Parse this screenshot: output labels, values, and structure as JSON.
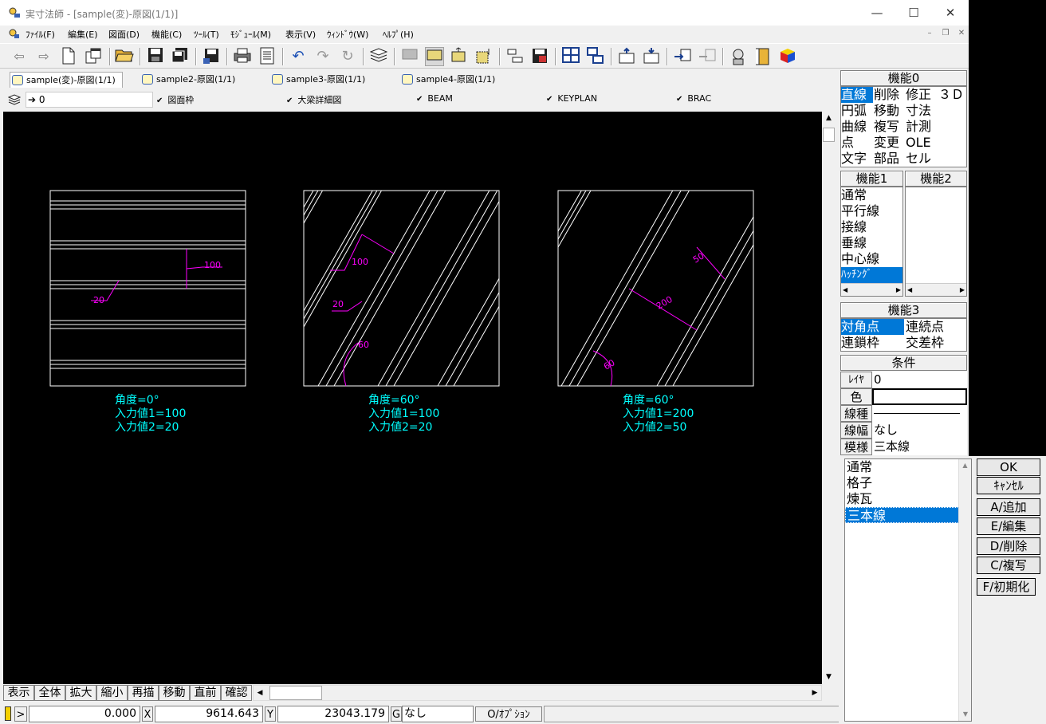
{
  "window": {
    "title": "実寸法師 - [sample(変)-原図(1/1)]",
    "min": "—",
    "max": "☐",
    "close": "✕"
  },
  "menu": [
    "ﾌｧｲﾙ(F)",
    "編集(E)",
    "図面(D)",
    "機能(C)",
    "ﾂｰﾙ(T)",
    "ﾓｼﾞｭｰﾙ(M)",
    "表示(V)",
    "ｳｨﾝﾄﾞｳ(W)",
    "ﾍﾙﾌﾟ(H)"
  ],
  "mdi": {
    "min": "–",
    "restore": "❐",
    "close": "✕"
  },
  "tabs": [
    {
      "label": "sample(変)-原図(1/1)",
      "active": true
    },
    {
      "label": "sample2-原図(1/1)",
      "active": false
    },
    {
      "label": "sample3-原図(1/1)",
      "active": false
    },
    {
      "label": "sample4-原図(1/1)",
      "active": false
    }
  ],
  "layers": {
    "current": "0",
    "items": [
      "図面枠",
      "大梁詳細図",
      "BEAM",
      "KEYPLAN",
      "BRAC"
    ]
  },
  "drawing": {
    "panels": [
      {
        "dims": [
          "100",
          "20"
        ],
        "captions": [
          "角度=0°",
          "入力値1=100",
          "入力値2=20"
        ]
      },
      {
        "dims": [
          "100",
          "20",
          "60"
        ],
        "captions": [
          "角度=60°",
          "入力値1=100",
          "入力値2=20"
        ]
      },
      {
        "dims": [
          "50",
          "200",
          "60"
        ],
        "captions": [
          "角度=60°",
          "入力値1=200",
          "入力値2=50"
        ]
      }
    ]
  },
  "commands": [
    "表示",
    "全体",
    "拡大",
    "縮小",
    "再描",
    "移動",
    "直前",
    "確認"
  ],
  "status": {
    "x_label": "X",
    "x_value": "9614.643",
    "y_label": "Y",
    "y_value": "23043.179",
    "prev_value": "0.000",
    "g_label": "G",
    "g_value": "なし",
    "option": "O/ｵﾌﾟｼｮﾝ"
  },
  "panel": {
    "kino0": {
      "header": "機能0",
      "rows": [
        [
          "直線",
          "削除",
          "修正",
          "３Ｄ"
        ],
        [
          "円弧",
          "移動",
          "寸法",
          ""
        ],
        [
          "曲線",
          "複写",
          "計測",
          ""
        ],
        [
          "点",
          "変更",
          "OLE",
          ""
        ],
        [
          "文字",
          "部品",
          "セル",
          ""
        ]
      ]
    },
    "kino1": {
      "header": "機能1",
      "items": [
        "通常",
        "平行線",
        "接線",
        "垂線",
        "中心線",
        "ﾊｯﾁﾝｸﾞ"
      ]
    },
    "kino2": {
      "header": "機能2"
    },
    "kino3": {
      "header": "機能3",
      "items": [
        "対角点",
        "連続点",
        "連鎖枠",
        "交差枠"
      ]
    },
    "conditions": {
      "header": "条件",
      "layer_label": "ﾚｲﾔ",
      "layer_value": "0",
      "color_label": "色",
      "linetype_label": "線種",
      "linewidth_label": "線幅",
      "linewidth_value": "なし",
      "pattern_label": "模様",
      "pattern_value": "三本線"
    }
  },
  "dialog": {
    "patterns": [
      "通常",
      "格子",
      "煉瓦",
      "三本線"
    ],
    "selected": "三本線",
    "buttons": {
      "ok": "OK",
      "cancel": "ｷｬﾝｾﾙ",
      "add": "A/追加",
      "edit": "E/編集",
      "delete": "D/削除",
      "copy": "C/複写",
      "init": "F/初期化"
    }
  },
  "colors": {
    "canvas_bg": "#000000",
    "drawing_line": "#ffffff",
    "dimension": "#ff00ff",
    "caption": "#00ffff",
    "selection": "#0078d7"
  }
}
